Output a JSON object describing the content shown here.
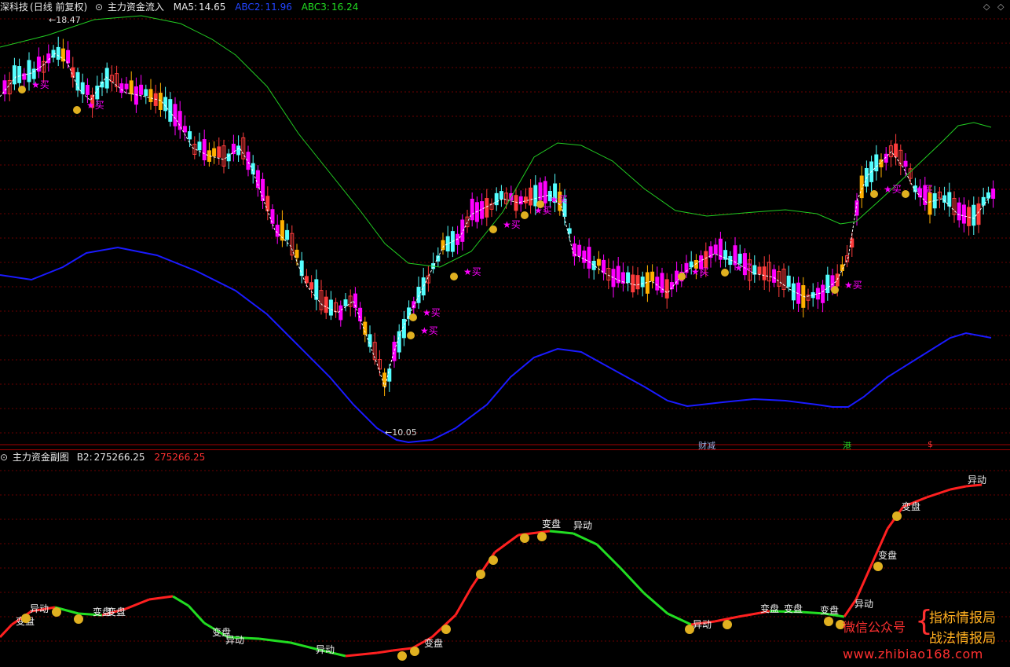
{
  "main_header": {
    "stock_name": "深科技",
    "period": "(日线 前复权)",
    "indicator_name": "主力资金流入",
    "ma5_label": "MA5:",
    "ma5_value": "14.65",
    "abc2_label": "ABC2:",
    "abc2_value": "11.96",
    "abc3_label": "ABC3:",
    "abc3_value": "16.24"
  },
  "sub_header": {
    "indicator_name": "主力资金副图",
    "b2_label": "B2:",
    "b2_value": "275266.25",
    "b2_value_red": "275266.25"
  },
  "price_marks": {
    "high": "18.47",
    "low": "10.05"
  },
  "bottom_markers": [
    "财减",
    "港",
    "$"
  ],
  "signals": {
    "buy": "★买",
    "sub_labels": [
      "变盘",
      "异动",
      "变盘",
      "变盘",
      "变盘",
      "异动",
      "异动",
      "变盘",
      "变盘",
      "异动",
      "异动",
      "变盘",
      "变盘",
      "变盘",
      "异动",
      "变盘"
    ]
  },
  "watermark": {
    "wechat": "微信公众号",
    "line1": "指标情报局",
    "line2": "战法情报局",
    "url": "www.zhibiao168.com"
  },
  "colors": {
    "up": "#ff3c3c",
    "down": "#54ffff",
    "main_buy": "#ff00ff",
    "main_buy_alt": "#ffb000",
    "ma_dash": "#ffffff",
    "abc2": "#1a1aff",
    "abc3": "#22cc22",
    "sub_up": "#ff2020",
    "sub_down": "#22dd22",
    "bag": "#e0b020"
  }
}
